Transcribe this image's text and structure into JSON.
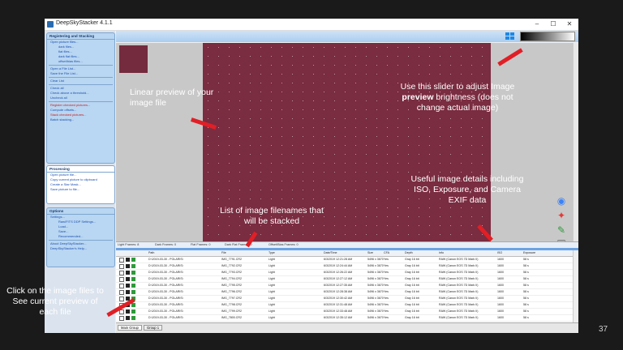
{
  "window": {
    "title": "DeepSkyStacker 4.1.1",
    "min": "–",
    "max": "☐",
    "close": "✕"
  },
  "sidebar": {
    "registering": {
      "header": "Registering and Stacking",
      "items": [
        "Open picture files...",
        "dark files...",
        "flat files...",
        "dark flat files...",
        "offset/bias files...",
        "Open a File List...",
        "Save the File List...",
        "Clear List",
        "Check all",
        "Check above a threshold...",
        "Uncheck all",
        "Register checked pictures...",
        "Compute offsets...",
        "Stack checked pictures...",
        "Batch stacking..."
      ]
    },
    "processing": {
      "header": "Processing",
      "items": [
        "Open picture file...",
        "Copy current picture to clipboard",
        "Create a Star Mask...",
        "Save picture to file..."
      ]
    },
    "options": {
      "header": "Options",
      "items": [
        "Settings...",
        "Raw/FITS DDP Settings...",
        "Load...",
        "Save...",
        "Recommended...",
        "About DeepSkyStacker...",
        "DeepSkyStacker's Help..."
      ]
    }
  },
  "frame_tabs": [
    "Light Frames: 8",
    "Dark Frames: 0",
    "Flat Frames: 0",
    "Dark Flat Frames: 0",
    "Offset/Bias Frames: 0"
  ],
  "table": {
    "headers": [
      "Path",
      "File",
      "Type",
      "Date/Time",
      "Size",
      "CFA",
      "Depth",
      "Info",
      "ISO",
      "Exposure"
    ],
    "rows": [
      [
        "D:\\2019-03-30 - POLARIS\\",
        "IMG_7791.CR2",
        "Light",
        "6/3/2019 12:21:28 AM",
        "5496 x 3670",
        "Yes",
        "Gray 16 bit",
        "RAW (Canon EOS 7D Mark II)",
        "1600",
        "58 s"
      ],
      [
        "D:\\2019-03-30 - POLARIS\\",
        "IMG_7792.CR2",
        "Light",
        "6/3/2019 12:24:44 AM",
        "5496 x 3670",
        "Yes",
        "Gray 16 bit",
        "RAW (Canon EOS 7D Mark II)",
        "1600",
        "58 s"
      ],
      [
        "D:\\2019-03-30 - POLARIS\\",
        "IMG_7793.CR2",
        "Light",
        "6/3/2019 12:26:22 AM",
        "5496 x 3670",
        "Yes",
        "Gray 16 bit",
        "RAW (Canon EOS 7D Mark II)",
        "1600",
        "58 s"
      ],
      [
        "D:\\2019-03-30 - POLARIS\\",
        "IMG_7794.CR2",
        "Light",
        "6/3/2019 12:27:12 AM",
        "5496 x 3670",
        "Yes",
        "Gray 16 bit",
        "RAW (Canon EOS 7D Mark II)",
        "1600",
        "58 s"
      ],
      [
        "D:\\2019-03-30 - POLARIS\\",
        "IMG_7795.CR2",
        "Light",
        "6/3/2019 12:27:35 AM",
        "5496 x 3670",
        "Yes",
        "Gray 16 bit",
        "RAW (Canon EOS 7D Mark II)",
        "1600",
        "58 s"
      ],
      [
        "D:\\2019-03-30 - POLARIS\\",
        "IMG_7796.CR2",
        "Light",
        "6/3/2019 12:28:38 AM",
        "5496 x 3670",
        "Yes",
        "Gray 16 bit",
        "RAW (Canon EOS 7D Mark II)",
        "1600",
        "58 s"
      ],
      [
        "D:\\2019-03-30 - POLARIS\\",
        "IMG_7797.CR2",
        "Light",
        "6/3/2019 12:30:42 AM",
        "5496 x 3670",
        "Yes",
        "Gray 16 bit",
        "RAW (Canon EOS 7D Mark II)",
        "1600",
        "58 s"
      ],
      [
        "D:\\2019-03-30 - POLARIS\\",
        "IMG_7798.CR2",
        "Light",
        "6/3/2019 12:31:48 AM",
        "5496 x 3670",
        "Yes",
        "Gray 16 bit",
        "RAW (Canon EOS 7D Mark II)",
        "1600",
        "58 s"
      ],
      [
        "D:\\2019-03-30 - POLARIS\\",
        "IMG_7799.CR2",
        "Light",
        "6/3/2019 12:33:48 AM",
        "5496 x 3670",
        "Yes",
        "Gray 16 bit",
        "RAW (Canon EOS 7D Mark II)",
        "1600",
        "58 s"
      ],
      [
        "D:\\2019-03-30 - POLARIS\\",
        "IMG_7800.CR2",
        "Light",
        "6/3/2019 12:35:12 AM",
        "5496 x 3670",
        "Yes",
        "Gray 16 bit",
        "RAW (Canon EOS 7D Mark II)",
        "1600",
        "58 s"
      ]
    ]
  },
  "bottom_tabs": [
    "Main Group",
    "Group 1"
  ],
  "annotations": {
    "preview": "Linear preview of your image file",
    "slider": "Use this slider to adjust Image preview brightness (does not change actual image)",
    "slider_bold_word": "preview",
    "details": "Useful image details including ISO, Exposure, and Camera EXIF data",
    "filenames": "List of image filenames that will be stacked",
    "click": "Click on the image files to See current preview of each file"
  },
  "page_number": "37",
  "colors": {
    "accent": "#e01f26",
    "image": "#7a2c40",
    "panel": "#b9d6f2"
  },
  "icons": [
    "grid-icon",
    "brightness-slider",
    "eye-icon",
    "star-icon",
    "pen-icon",
    "save-icon"
  ]
}
